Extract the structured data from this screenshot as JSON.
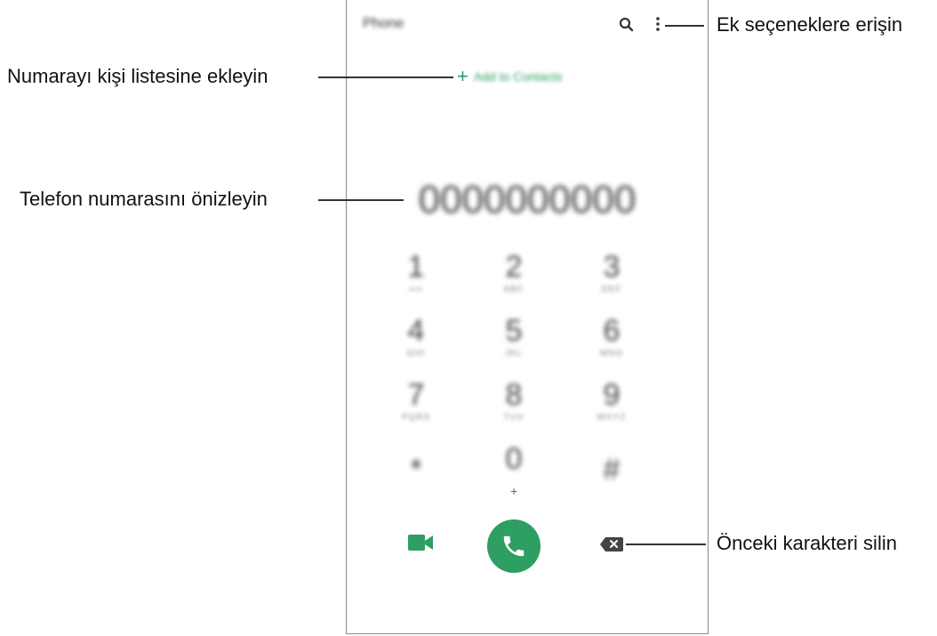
{
  "phone": {
    "title": "Phone",
    "add_to_contacts": "Add to Contacts",
    "number_preview": "0000000000",
    "keys": [
      {
        "digit": "1",
        "letters": "∞∞"
      },
      {
        "digit": "2",
        "letters": "ABC"
      },
      {
        "digit": "3",
        "letters": "DEF"
      },
      {
        "digit": "4",
        "letters": "GHI"
      },
      {
        "digit": "5",
        "letters": "JKL"
      },
      {
        "digit": "6",
        "letters": "MNO"
      },
      {
        "digit": "7",
        "letters": "PQRS"
      },
      {
        "digit": "8",
        "letters": "TUV"
      },
      {
        "digit": "9",
        "letters": "WXYZ"
      },
      {
        "digit": "*",
        "letters": ""
      },
      {
        "digit": "0",
        "letters": "+"
      },
      {
        "digit": "#",
        "letters": ""
      }
    ],
    "icons": {
      "search": "search-icon",
      "more": "more-options-icon",
      "add": "plus-icon",
      "video": "video-call-icon",
      "call": "phone-icon",
      "backspace": "backspace-icon"
    },
    "accent_color": "#2e9e62"
  },
  "callouts": {
    "more_options": "Ek seçeneklere erişin",
    "add_contact": "Numarayı kişi listesine ekleyin",
    "preview_number": "Telefon numarasını önizleyin",
    "delete_char": "Önceki karakteri silin"
  }
}
